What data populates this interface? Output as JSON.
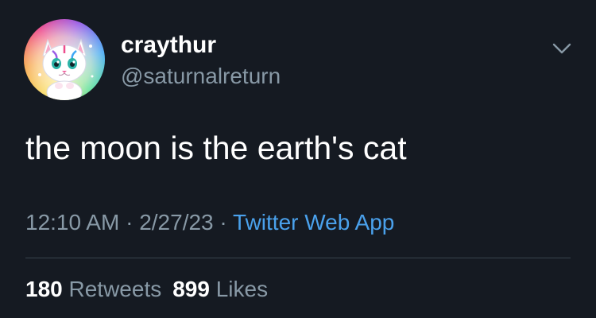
{
  "tweet": {
    "author": {
      "display_name": "craythur",
      "handle": "@saturnalreturn",
      "avatar_icon": "rainbow-cat-avatar"
    },
    "menu_icon": "chevron-down-icon",
    "text": "the moon is the earth's cat",
    "time": "12:10 AM",
    "separator": " · ",
    "date": "2/27/23",
    "source": "Twitter Web App",
    "stats": {
      "retweets_count": "180",
      "retweets_label": "Retweets",
      "likes_count": "899",
      "likes_label": "Likes"
    }
  },
  "colors": {
    "background": "#151a22",
    "primary_text": "#ffffff",
    "secondary_text": "#8899a6",
    "link": "#4aa1ec",
    "divider": "#38444d"
  }
}
